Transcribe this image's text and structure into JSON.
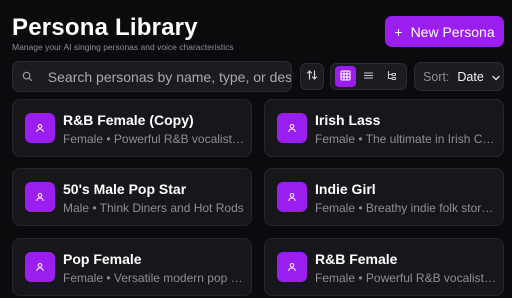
{
  "header": {
    "title": "Persona Library",
    "subtitle": "Manage your AI singing personas and voice characteristics",
    "new_button_label": "New Persona",
    "new_button_icon": "plus-icon"
  },
  "toolbar": {
    "search_placeholder": "Search personas by name, type, or description...",
    "sort_label": "Sort:",
    "sort_value": "Date",
    "active_view": "grid"
  },
  "colors": {
    "accent": "#9b1ef0",
    "background": "#0b0b0e",
    "card": "#17171b"
  },
  "personas": [
    {
      "name": "R&B Female (Copy)",
      "type": "Female",
      "description": "Powerful R&B vocalist with soulful runs"
    },
    {
      "name": "Irish Lass",
      "type": "Female",
      "description": "The ultimate in Irish Charm"
    },
    {
      "name": "50's Male Pop Star",
      "type": "Male",
      "description": "Think Diners and Hot Rods"
    },
    {
      "name": "Indie Girl",
      "type": "Female",
      "description": "Breathy indie folk storyteller"
    },
    {
      "name": "Pop Female",
      "type": "Female",
      "description": "Versatile modern pop vocalist"
    },
    {
      "name": "R&B Female",
      "type": "Female",
      "description": "Powerful R&B vocalist with soulful runs"
    }
  ]
}
